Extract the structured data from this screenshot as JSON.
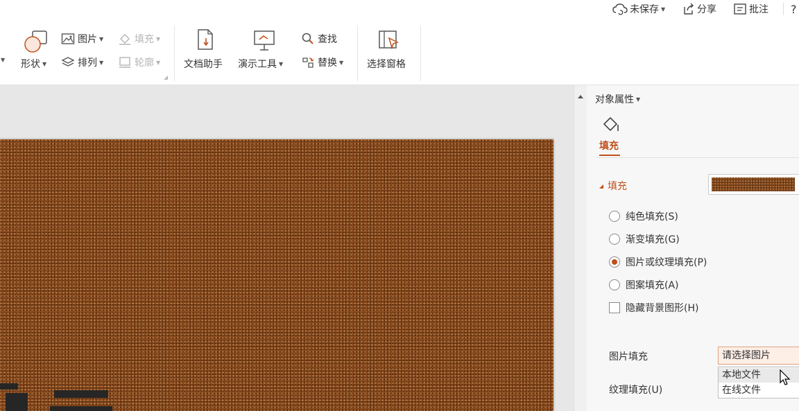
{
  "topbar": {
    "unsaved": "未保存",
    "share": "分享",
    "comment": "批注",
    "help": "?"
  },
  "ribbon": {
    "shape": "形状",
    "picture": "图片",
    "fill": "填充",
    "arrange": "排列",
    "outline": "轮廓",
    "doc_helper": "文档助手",
    "present_tools": "演示工具",
    "find": "查找",
    "replace": "替换",
    "select_pane": "选择窗格"
  },
  "panel": {
    "title": "对象属性",
    "tab_fill": "填充",
    "section_fill": "填充",
    "options": [
      {
        "label": "纯色填充(S)",
        "checked": false
      },
      {
        "label": "渐变填充(G)",
        "checked": false
      },
      {
        "label": "图片或纹理填充(P)",
        "checked": true
      },
      {
        "label": "图案填充(A)",
        "checked": false
      }
    ],
    "hide_bg": "隐藏背景图形(H)",
    "picture_fill_label": "图片填充",
    "picture_select": "请选择图片",
    "picture_menu": [
      "本地文件",
      "在线文件"
    ],
    "texture_fill_label": "纹理填充(U)"
  },
  "colors": {
    "accent": "#c0501c",
    "slide_bg": "#8a4a1c",
    "canvas_bg": "#e7e7e7",
    "panel_bg": "#f7f7f7"
  },
  "icons": {
    "cloud": "cloud-sync-icon",
    "share": "share-icon",
    "comment": "comment-icon",
    "shape": "shape-icon",
    "picture": "picture-icon",
    "fill": "fill-bucket-icon",
    "arrange": "layers-icon",
    "outline": "outline-icon",
    "doc_helper": "doc-helper-icon",
    "present_tools": "presentation-icon",
    "find": "magnifier-icon",
    "replace": "replace-icon",
    "select_pane": "select-pane-icon"
  }
}
